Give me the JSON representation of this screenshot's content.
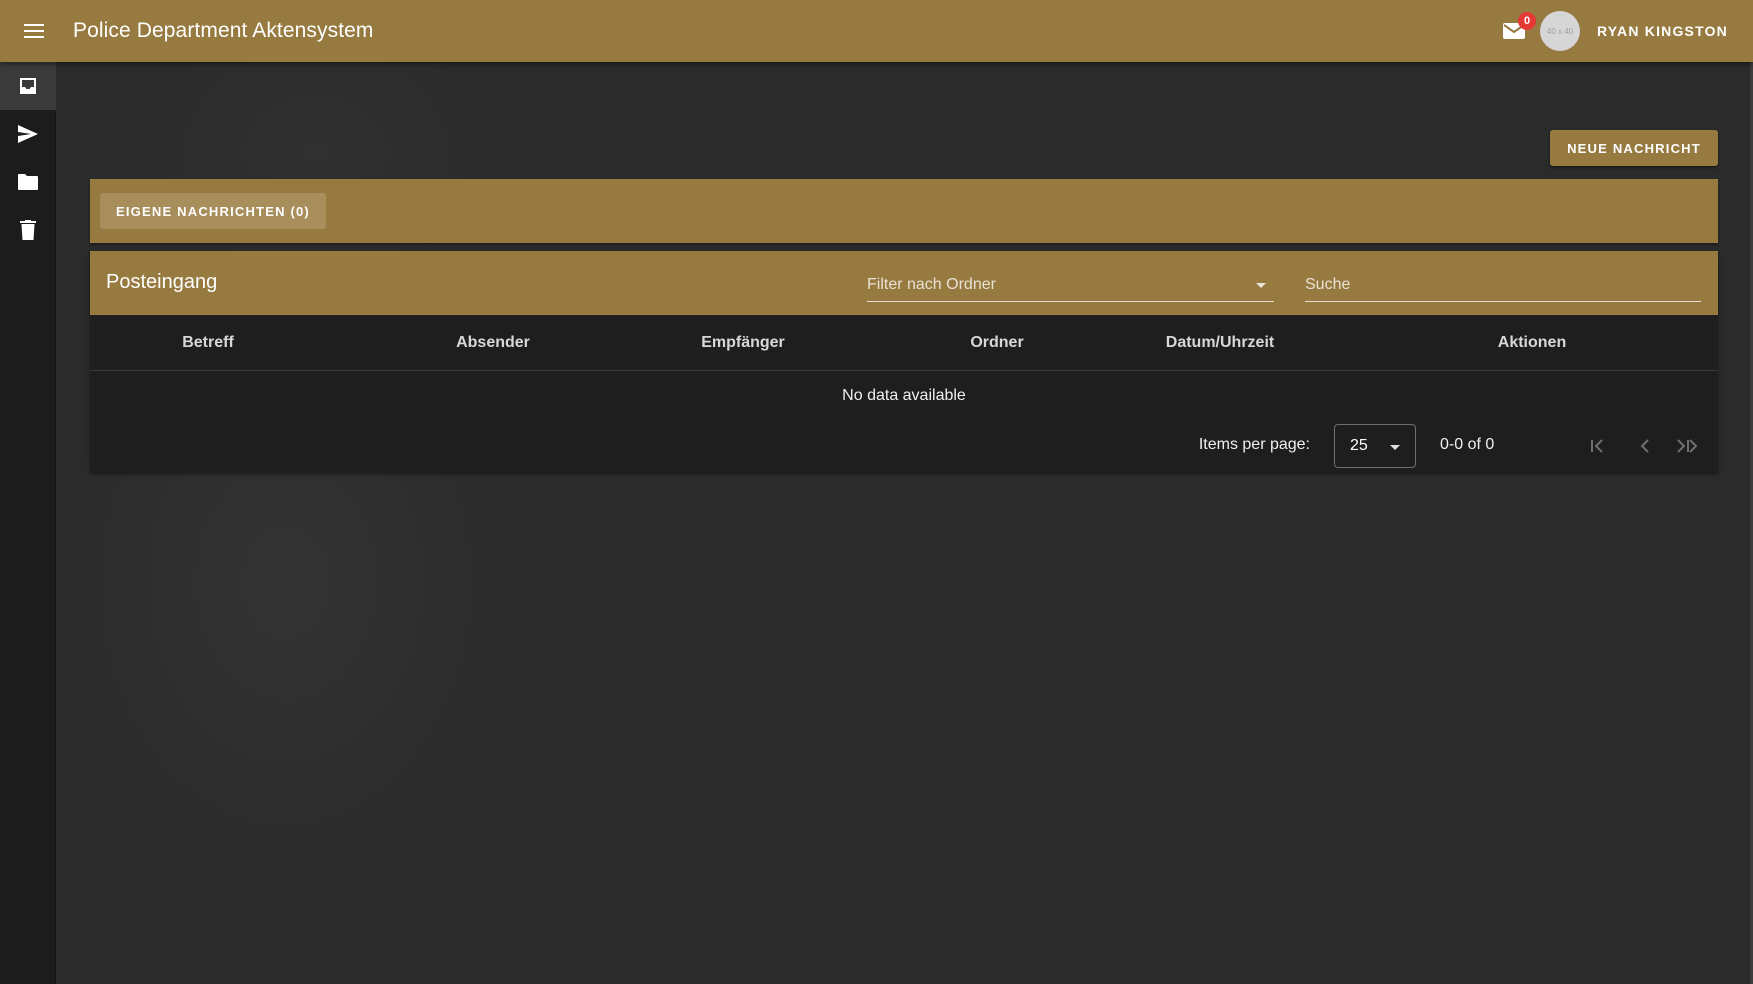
{
  "header": {
    "title": "Police Department Aktensystem",
    "mail_badge": "0",
    "avatar_text": "40 x 40",
    "user_name": "RYAN KINGSTON"
  },
  "sidebar": {
    "items": [
      {
        "icon": "inbox-icon",
        "active": true
      },
      {
        "icon": "send-icon",
        "active": false
      },
      {
        "icon": "folder-icon",
        "active": false
      },
      {
        "icon": "trash-icon",
        "active": false
      }
    ]
  },
  "actions": {
    "new_message_label": "NEUE NACHRICHT",
    "own_messages_label": "EIGENE NACHRICHTEN (0)"
  },
  "inbox": {
    "title": "Posteingang",
    "filter_placeholder": "Filter nach Ordner",
    "search_placeholder": "Suche",
    "columns": [
      "Betreff",
      "Absender",
      "Empfänger",
      "Ordner",
      "Datum/Uhrzeit",
      "Aktionen"
    ],
    "empty_text": "No data available",
    "items_per_page_label": "Items per page:",
    "items_per_page_value": "25",
    "range_text": "0-0 of 0"
  },
  "colors": {
    "accent": "#977a40",
    "background": "#2b2b2b",
    "sidebar": "#1c1c1c",
    "table": "#1e1e1e",
    "badge": "#e53935"
  }
}
